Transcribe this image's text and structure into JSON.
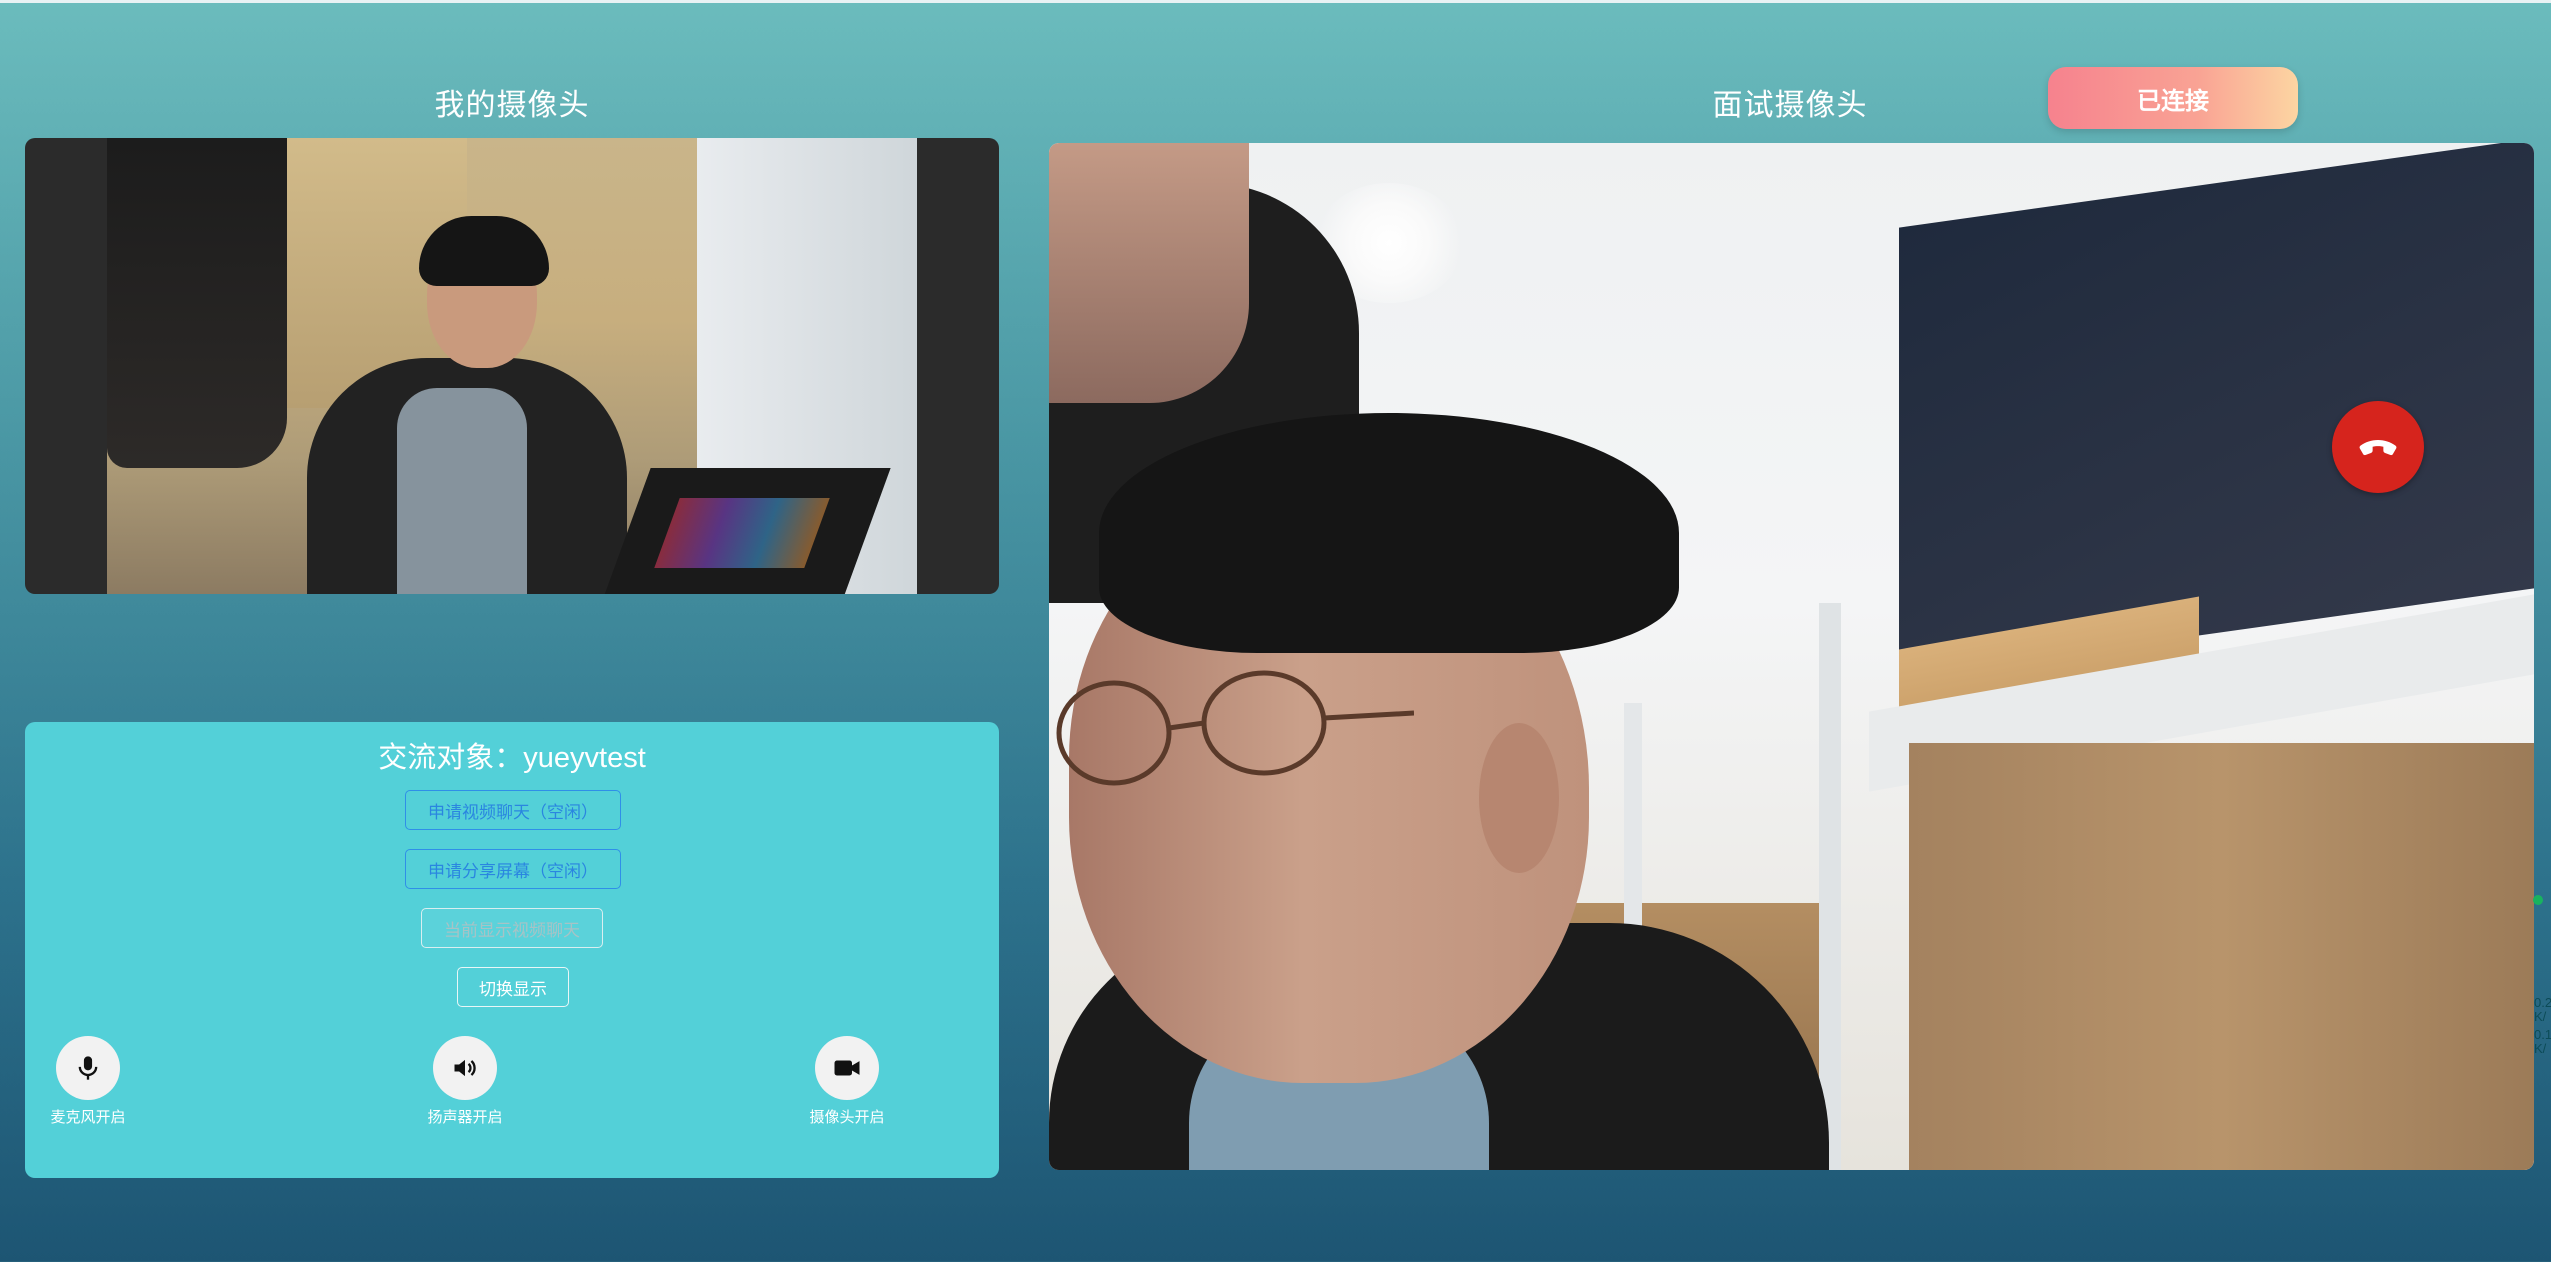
{
  "my_camera": {
    "title": "我的摄像头"
  },
  "interview_camera": {
    "title": "面试摄像头"
  },
  "connection": {
    "status_label": "已连接"
  },
  "panel": {
    "title": "交流对象：yueyvtest",
    "apply_video_label": "申请视频聊天（空闲）",
    "apply_share_label": "申请分享屏幕（空闲）",
    "current_display_label": "当前显示视频聊天",
    "switch_display_label": "切换显示"
  },
  "controls": {
    "mic_label": "麦克风开启",
    "speaker_label": "扬声器开启",
    "camera_label": "摄像头开启"
  },
  "icons": {
    "hangup": "phone-hangup-icon",
    "mic": "microphone-icon",
    "speaker": "speaker-icon",
    "camera": "video-camera-icon"
  },
  "edge_stats": {
    "line1": "0.2",
    "line2": "K/",
    "line3": "0.1",
    "line4": "K/"
  },
  "colors": {
    "status_gradient_start": "#f6828e",
    "status_gradient_end": "#fcd5a2",
    "panel_bg": "#53d0d8",
    "primary_button": "#2a86e0",
    "hangup_red": "#d6241d"
  }
}
